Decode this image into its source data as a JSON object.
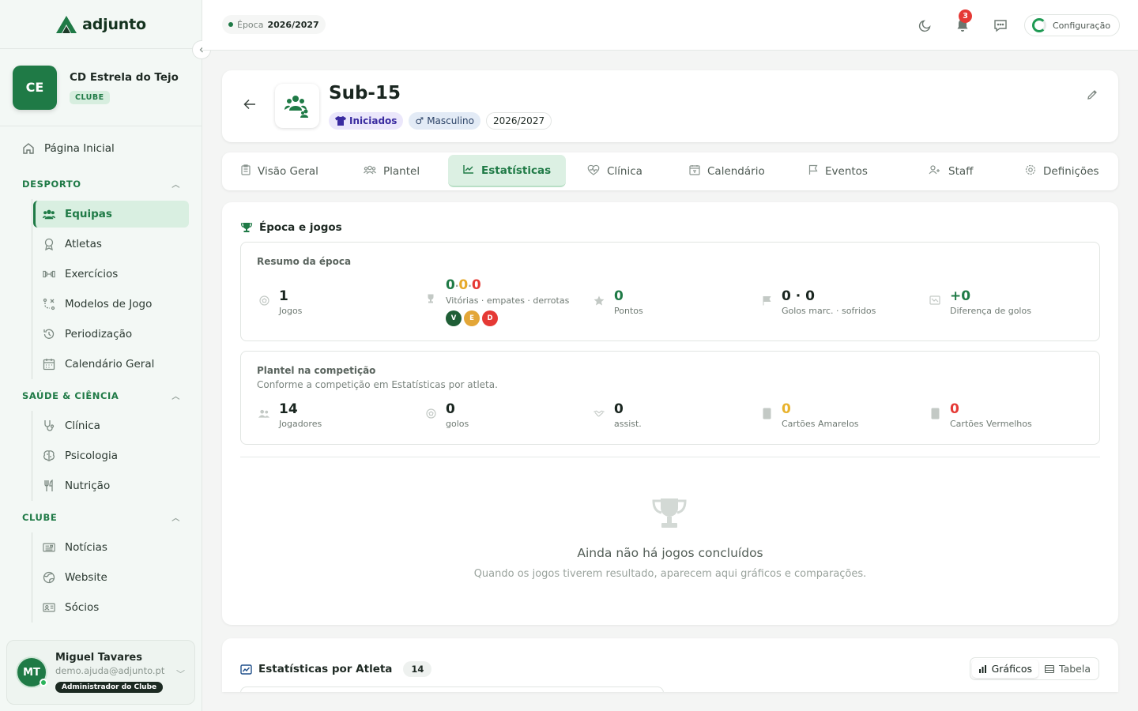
{
  "app": {
    "name": "adjunto"
  },
  "club": {
    "initials": "CE",
    "name": "CD Estrela do Tejo",
    "badge": "CLUBE"
  },
  "nav": {
    "home": "Página Inicial",
    "sections": [
      {
        "title": "DESPORTO",
        "items": [
          "Equipas",
          "Atletas",
          "Exercícios",
          "Modelos de Jogo",
          "Periodização",
          "Calendário Geral"
        ]
      },
      {
        "title": "SAÚDE & CIÊNCIA",
        "items": [
          "Clínica",
          "Psicologia",
          "Nutrição"
        ]
      },
      {
        "title": "CLUBE",
        "items": [
          "Notícias",
          "Website",
          "Sócios"
        ]
      }
    ],
    "active": "Equipas"
  },
  "user": {
    "initials": "MT",
    "name": "Miguel Tavares",
    "email": "demo.ajuda@adjunto.pt",
    "role": "Administrador do Clube"
  },
  "topbar": {
    "season_label": "Época",
    "season_value": "2026/2027",
    "notifications": "3",
    "config_label": "Configuração"
  },
  "team": {
    "name": "Sub-15",
    "tags": [
      "Iniciados",
      "Masculino",
      "2026/2027"
    ]
  },
  "tabs": [
    "Visão Geral",
    "Plantel",
    "Estatísticas",
    "Clínica",
    "Calendário",
    "Eventos",
    "Staff",
    "Definições"
  ],
  "active_tab": "Estatísticas",
  "season_section": {
    "title": "Época e jogos",
    "summary": {
      "title": "Resumo da época",
      "games": {
        "value": "1",
        "label": "Jogos"
      },
      "record": {
        "wins": "0",
        "draws": "0",
        "losses": "0",
        "label": "Vitórias · empates · derrotas",
        "pills": [
          "V",
          "E",
          "D"
        ]
      },
      "points": {
        "value": "0",
        "label": "Pontos"
      },
      "goals": {
        "scored": "0",
        "conceded": "0",
        "label": "Golos marc. · sofridos"
      },
      "goal_diff": {
        "value": "+0",
        "label": "Diferença de golos"
      }
    },
    "squad": {
      "title": "Plantel na competição",
      "subtitle": "Conforme a competição em Estatísticas por atleta.",
      "players": {
        "value": "14",
        "label": "Jogadores"
      },
      "goals": {
        "value": "0",
        "label": "golos"
      },
      "assists": {
        "value": "0",
        "label": "assist."
      },
      "yellow": {
        "value": "0",
        "label": "Cartões Amarelos"
      },
      "red": {
        "value": "0",
        "label": "Cartões Vermelhos"
      }
    },
    "empty": {
      "title": "Ainda não há jogos concluídos",
      "subtitle": "Quando os jogos tiverem resultado, aparecem aqui gráficos e comparações."
    }
  },
  "athlete_stats": {
    "title": "Estatísticas por Atleta",
    "count": "14",
    "views": [
      "Gráficos",
      "Tabela"
    ],
    "active_view": "Gráficos"
  },
  "colors": {
    "accent": "#1f7a46",
    "win": "#1f7a46",
    "draw": "#e6a92a",
    "loss": "#e53935"
  }
}
